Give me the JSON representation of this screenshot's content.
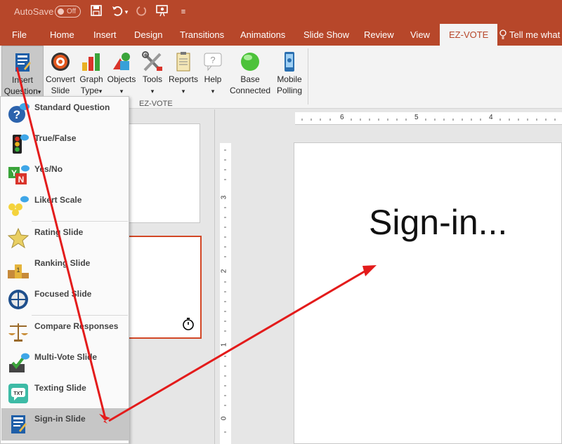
{
  "titlebar": {
    "autosave_label": "AutoSave",
    "autosave_state": "Off",
    "quick_access": [
      "save-icon",
      "undo-icon",
      "redo-icon",
      "present-icon",
      "customize-icon"
    ]
  },
  "tabs": [
    {
      "label": "File"
    },
    {
      "label": "Home"
    },
    {
      "label": "Insert"
    },
    {
      "label": "Design"
    },
    {
      "label": "Transitions"
    },
    {
      "label": "Animations"
    },
    {
      "label": "Slide Show"
    },
    {
      "label": "Review"
    },
    {
      "label": "View"
    },
    {
      "label": "EZ-VOTE",
      "active": true
    },
    {
      "label": "Tell me what"
    }
  ],
  "ribbon": {
    "buttons": [
      {
        "line1": "Insert",
        "line2": "Question",
        "arrow": "▾",
        "icon": "insert-question-icon"
      },
      {
        "line1": "Convert",
        "line2": "Slide",
        "icon": "convert-slide-icon"
      },
      {
        "line1": "Graph",
        "line2": "Type",
        "arrow": "▾",
        "icon": "graph-type-icon"
      },
      {
        "line1": "Objects",
        "line2": "",
        "arrow": "▾",
        "icon": "objects-icon"
      },
      {
        "line1": "Tools",
        "line2": "",
        "arrow": "▾",
        "icon": "tools-icon"
      },
      {
        "line1": "Reports",
        "line2": "",
        "arrow": "▾",
        "icon": "reports-icon"
      },
      {
        "line1": "Help",
        "line2": "",
        "arrow": "▾",
        "icon": "help-icon"
      },
      {
        "line1": "Base",
        "line2": "Connected",
        "icon": "base-connected-icon"
      },
      {
        "line1": "Mobile",
        "line2": "Polling",
        "icon": "mobile-polling-icon"
      }
    ],
    "group_label": "EZ-VOTE"
  },
  "dropdown": {
    "items": [
      {
        "label": "Standard Question",
        "icon": "standard-question-icon"
      },
      {
        "label": "True/False",
        "icon": "traffic-light-icon"
      },
      {
        "label": "Yes/No",
        "icon": "yes-no-icon"
      },
      {
        "label": "Likert Scale",
        "icon": "likert-faces-icon"
      },
      {
        "label": "Rating Slide",
        "icon": "star-icon"
      },
      {
        "label": "Ranking Slide",
        "icon": "podium-icon"
      },
      {
        "label": "Focused Slide",
        "icon": "crosshair-icon"
      },
      {
        "label": "Compare Responses",
        "icon": "scales-icon"
      },
      {
        "label": "Multi-Vote Slide",
        "icon": "multi-vote-icon"
      },
      {
        "label": "Texting Slide",
        "icon": "texting-icon"
      },
      {
        "label": "Sign-in Slide",
        "icon": "sign-in-icon",
        "highlighted": true
      }
    ]
  },
  "rulers": {
    "horizontal": [
      "6",
      "5",
      "4"
    ],
    "vertical": [
      "3",
      "2",
      "1",
      "0"
    ]
  },
  "slide": {
    "title": "Sign-in..."
  },
  "colors": {
    "accent": "#b7472a",
    "annotation_arrow": "#e31b1b",
    "selected_thumb_border": "#d24726"
  }
}
